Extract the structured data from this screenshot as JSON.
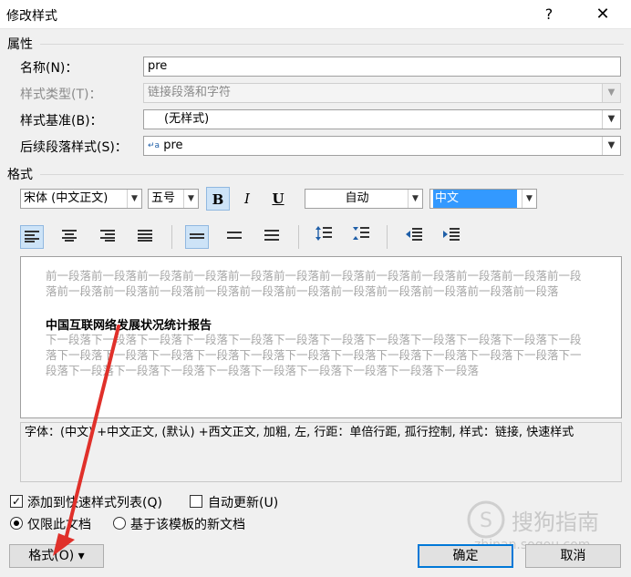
{
  "dialog": {
    "title": "修改样式",
    "help_glyph": "?",
    "close_glyph": "✕"
  },
  "properties": {
    "section_label": "属性",
    "name_label": "名称(N)：",
    "name_value": "pre",
    "style_type_label": "样式类型(T)：",
    "style_type_value": "链接段落和字符",
    "based_on_label": "样式基准(B)：",
    "based_on_value": "(无样式)",
    "next_para_label": "后续段落样式(S)：",
    "next_para_icon": "↵a",
    "next_para_value": "pre"
  },
  "format": {
    "section_label": "格式",
    "font": "宋体 (中文正文)",
    "size": "五号",
    "bold": "B",
    "italic": "I",
    "underline": "U",
    "color": "自动",
    "language": "中文"
  },
  "preview": {
    "prev_text": "前一段落前一段落前一段落前一段落前一段落前一段落前一段落前一段落前一段落前一段落前一段落前一段落前一段落前一段落前一段落前一段落前一段落前一段落前一段落前一段落前一段落前一段落前一段落",
    "sample_text": "中国互联网络发展状况统计报告",
    "next_text": "下一段落下一段落下一段落下一段落下一段落下一段落下一段落下一段落下一段落下一段落下一段落下一段落下一段落下一段落下一段落下一段落下一段落下一段落下一段落下一段落下一段落下一段落下一段落下一段落下一段落下一段落下一段落下一段落下一段落下一段落下一段落下一段落下一段落"
  },
  "description": "字体：(中文) +中文正文, (默认) +西文正文, 加粗, 左, 行距：单倍行距, 孤行控制, 样式：链接, 快速样式",
  "options": {
    "add_to_gallery": "添加到快速样式列表(Q)",
    "auto_update": "自动更新(U)",
    "only_this_doc": "仅限此文档",
    "new_docs_template": "基于该模板的新文档"
  },
  "buttons": {
    "format": "格式(O) ▾",
    "ok": "确定",
    "cancel": "取消"
  },
  "watermark": {
    "brand": "搜狗指南",
    "url": "zhinan.sogou.com"
  }
}
